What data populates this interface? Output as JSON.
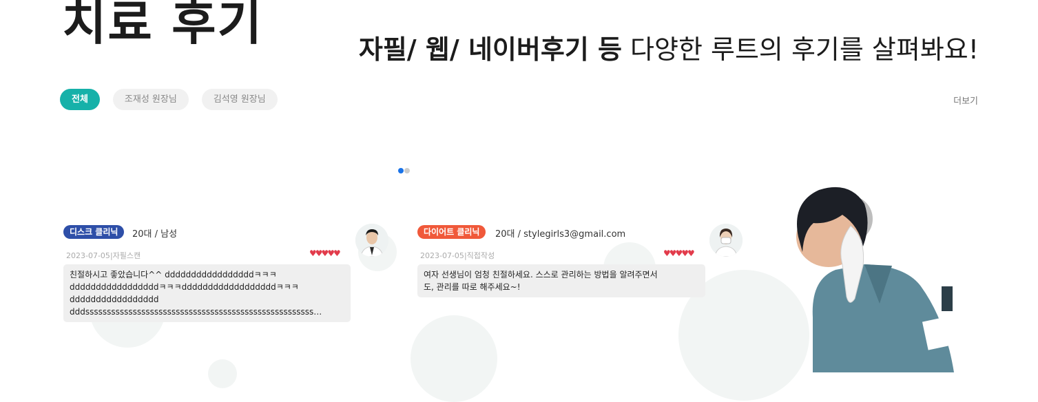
{
  "page": {
    "title": "치료 후기",
    "headline_bold": "자필/ 웹/ 네이버후기 등",
    "headline_rest": " 다양한 루트의 후기를 살펴봐요!"
  },
  "filters": {
    "tabs": [
      {
        "label": "전체",
        "active": true
      },
      {
        "label": "조재성 원장님",
        "active": false
      },
      {
        "label": "김석영 원장님",
        "active": false
      }
    ],
    "more_label": "더보기"
  },
  "slider": {
    "pages": 2,
    "current": 1
  },
  "reviews": [
    {
      "clinic": "디스크 클리닉",
      "clinic_color": "#2e4fa8",
      "author_meta": "20대 / 남성",
      "date": "2023-07-05",
      "source": "자필스캔",
      "rating": 5,
      "hearts": "♥♥♥♥♥",
      "text_lines": [
        "친절하시고 좋았습니다^^ dddddddddddddddddㅋㅋㅋ",
        "dddddddddddddddddㅋㅋㅋddddddddddddddddddㅋㅋㅋ",
        "ddddddddddddddddd",
        "dddsssssssssssssssssssssssssssssssssssssssssssssssssssss…"
      ]
    },
    {
      "clinic": "다이어트 클리닉",
      "clinic_color": "#f0593a",
      "author_meta": "20대 / stylegirls3@gmail.com",
      "date": "2023-07-05",
      "source": "직접작성",
      "rating": 5,
      "hearts": "♥♥♥♥♥",
      "text_lines": [
        "여자 선생님이 엄청 친절하세요. 스스로 관리하는 방법을 알려주면서",
        "도, 관리를 따로 해주세요~!"
      ]
    }
  ]
}
